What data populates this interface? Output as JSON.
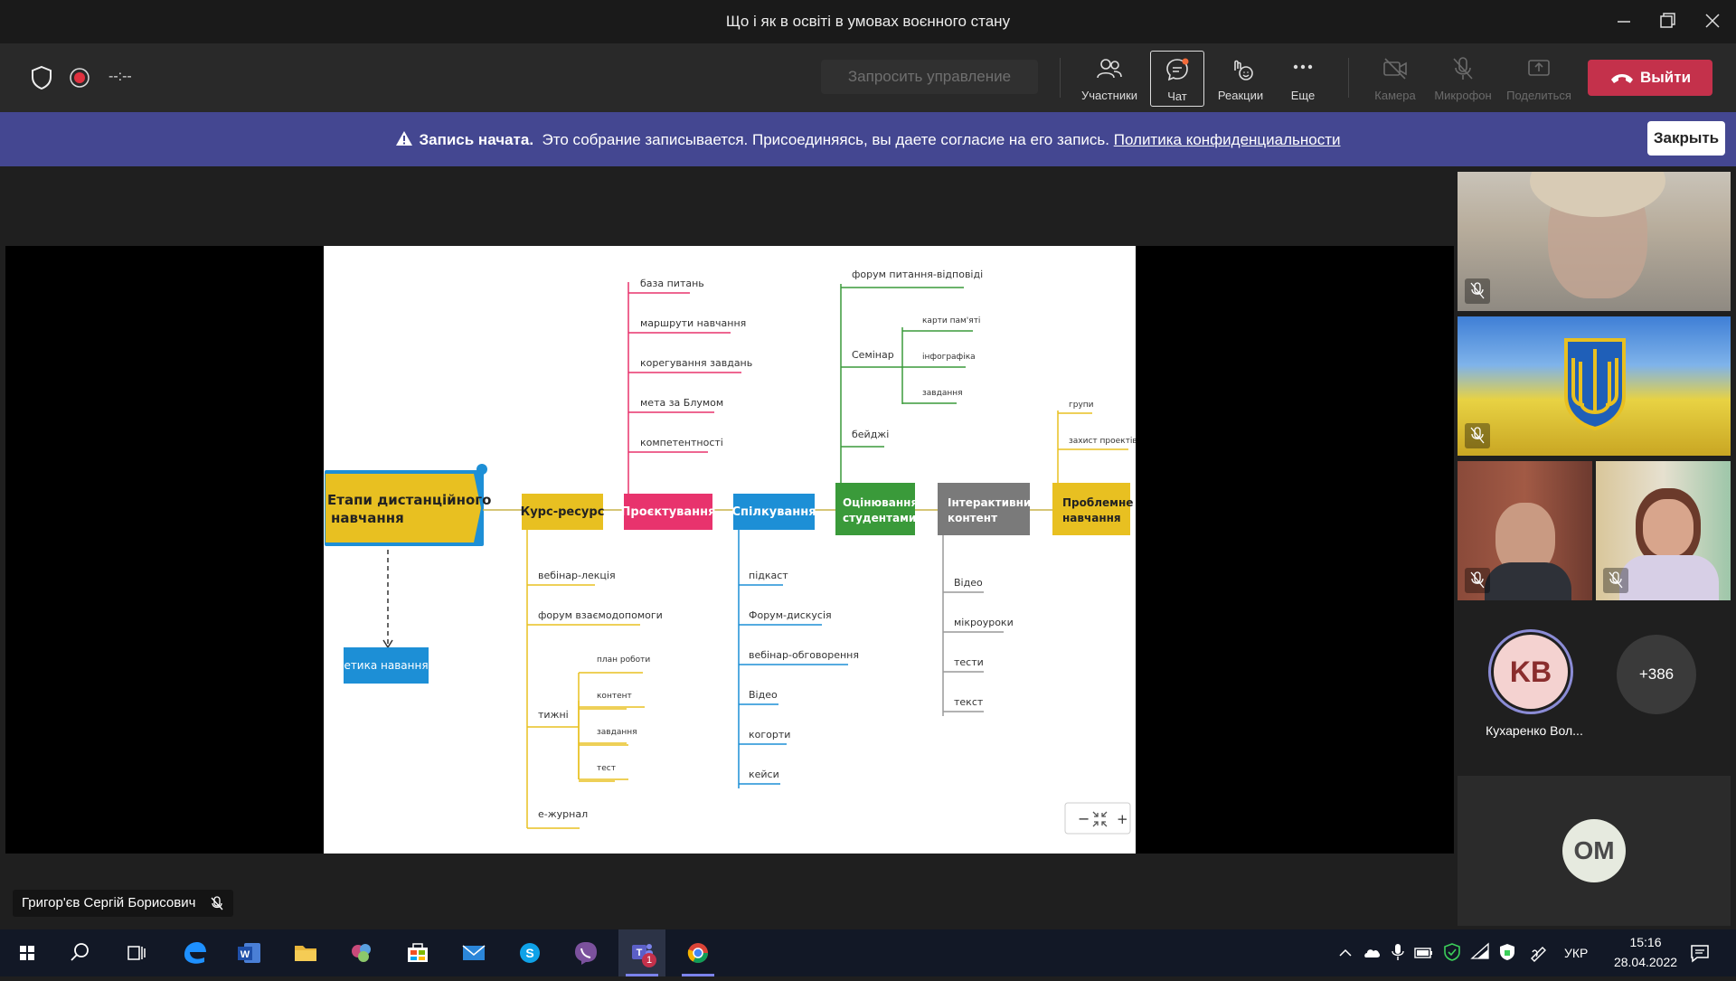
{
  "window": {
    "title": "Що і як в освіті в умовах воєнного стану"
  },
  "toolbar": {
    "timer": "--:--",
    "request_control": "Запросить управление",
    "participants": "Участники",
    "chat": "Чат",
    "reactions": "Реакции",
    "more": "Еще",
    "camera": "Камера",
    "mic": "Микрофон",
    "share": "Поделиться",
    "leave": "Выйти"
  },
  "banner": {
    "title": "Запись начата.",
    "text": "Это собрание записывается. Присоединяясь, вы даете согласие на его запись.",
    "link": "Политика конфиденциальности",
    "close": "Закрыть"
  },
  "mindmap": {
    "root": "Етапи дистанційного навчання",
    "ethics": "етика навання",
    "branches": {
      "course": "Курс-ресурс",
      "design": "Проєктування",
      "comm": "Спілкування",
      "eval": "Оцінювання студентами",
      "interactive": "Інтерактивний контент",
      "problem": "Проблемне навчання"
    },
    "course_items": [
      "вебінар-лекція",
      "форум взаємодопомоги",
      "тижні",
      "е-журнал"
    ],
    "weeks_items": [
      "план роботи",
      "контент",
      "завдання",
      "тест"
    ],
    "design_items": [
      "база питань",
      "маршрути навчання",
      "корегування завдань",
      "мета за Блумом",
      "компетентності"
    ],
    "comm_items": [
      "підкаст",
      "Форум-дискусія",
      "вебінар-обговорення",
      "Відео",
      "когорти",
      "кейси"
    ],
    "eval_items": [
      "форум питання-відповіді",
      "Семінар",
      "бейджі"
    ],
    "seminar_items": [
      "карти пам'яті",
      "інфографіка",
      "завдання"
    ],
    "interactive_items": [
      "Відео",
      "мікроуроки",
      "тести",
      "текст"
    ],
    "problem_items": [
      "групи",
      "захист проектів"
    ],
    "zoom_minus": "−",
    "zoom_plus": "+"
  },
  "presenter": {
    "name": "Григор'єв Сергій Борисович"
  },
  "participants": {
    "kv_initials": "KB",
    "kv_name": "Кухаренко Вол...",
    "more_count": "+386",
    "om_initials": "OM"
  },
  "taskbar": {
    "lang": "УКР",
    "time": "15:16",
    "date": "28.04.2022",
    "teams_badge": "1"
  },
  "colors": {
    "accent_red": "#c4314b",
    "banner": "#444791",
    "yellow": "#e8c021",
    "pink": "#e8336d",
    "blue": "#1d8fd6",
    "green": "#3a9a3a",
    "gray": "#7a7a7a"
  }
}
